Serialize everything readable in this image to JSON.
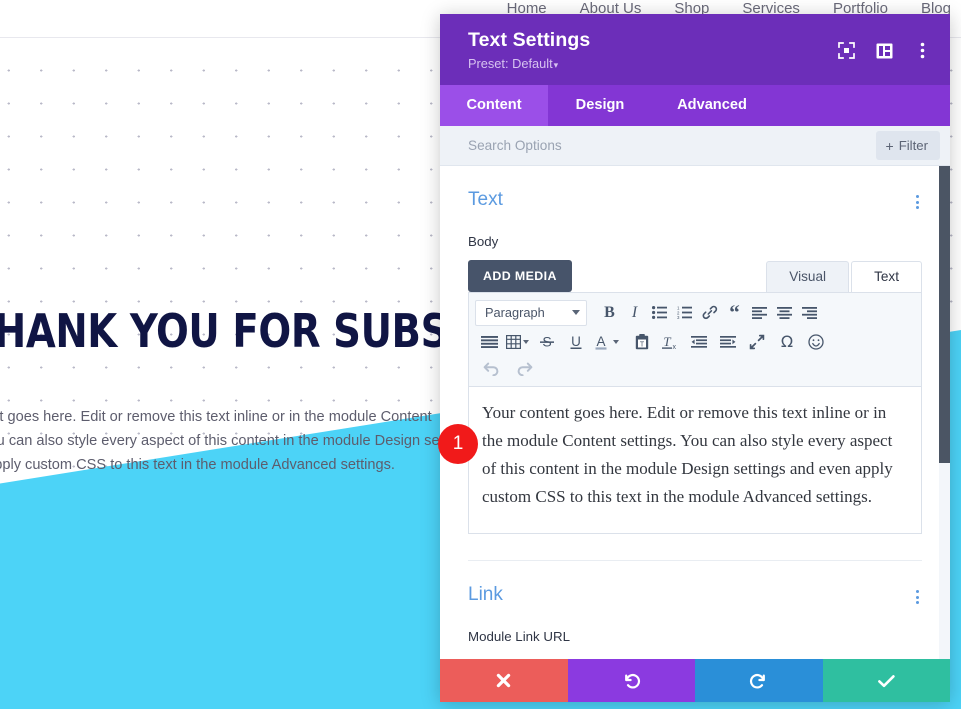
{
  "background_page": {
    "nav": {
      "items": [
        {
          "label": "Home"
        },
        {
          "label": "About Us"
        },
        {
          "label": "Shop"
        },
        {
          "label": "Services"
        },
        {
          "label": "Portfolio"
        },
        {
          "label": "Blog"
        }
      ]
    },
    "hero": {
      "heading": "THANK YOU FOR SUBSCRIBING!",
      "body": "Your content goes here. Edit or remove this text inline or in the module Content settings. You can also style every aspect of this content in the module Design settings and even apply custom CSS to this text in the module Advanced settings."
    },
    "colors": {
      "wedge": "#4cd3f7",
      "heading": "#101544"
    }
  },
  "step_badge": {
    "number": "1",
    "color": "#f11a1a"
  },
  "modal": {
    "header": {
      "title": "Text Settings",
      "preset_label": "Preset: Default",
      "preset_caret": "▾",
      "icons": [
        {
          "name": "focus-target-icon"
        },
        {
          "name": "panel-layout-icon"
        },
        {
          "name": "more-vertical-icon"
        }
      ],
      "color": "#6c2eb9"
    },
    "tabs": [
      {
        "label": "Content",
        "active": true
      },
      {
        "label": "Design",
        "active": false
      },
      {
        "label": "Advanced",
        "active": false
      }
    ],
    "search": {
      "placeholder": "Search Options",
      "value": "",
      "filter_label": "Filter",
      "filter_plus": "+"
    },
    "sections": [
      {
        "title": "Text",
        "field_label": "Body",
        "add_media_label": "ADD MEDIA",
        "mode_tabs": [
          {
            "label": "Visual",
            "active": false
          },
          {
            "label": "Text",
            "active": true
          }
        ],
        "toolbar": {
          "format_select": "Paragraph",
          "row1": [
            {
              "name": "bold-icon",
              "glyph": "B"
            },
            {
              "name": "italic-icon",
              "glyph": "I"
            },
            {
              "name": "bulleted-list-icon"
            },
            {
              "name": "numbered-list-icon"
            },
            {
              "name": "link-icon"
            },
            {
              "name": "blockquote-icon"
            },
            {
              "name": "align-left-icon"
            },
            {
              "name": "align-center-icon"
            },
            {
              "name": "align-right-icon"
            }
          ],
          "row2": [
            {
              "name": "align-justify-icon"
            },
            {
              "name": "table-icon"
            },
            {
              "name": "strikethrough-icon",
              "glyph": "S"
            },
            {
              "name": "underline-icon",
              "glyph": "U"
            },
            {
              "name": "text-color-icon",
              "glyph": "A"
            },
            {
              "name": "paste-as-text-icon"
            },
            {
              "name": "clear-formatting-icon"
            },
            {
              "name": "outdent-icon"
            },
            {
              "name": "indent-icon"
            },
            {
              "name": "fullscreen-icon"
            },
            {
              "name": "special-character-icon",
              "glyph": "Ω"
            },
            {
              "name": "emoji-icon"
            }
          ],
          "row3": [
            {
              "name": "undo-icon"
            },
            {
              "name": "redo-icon"
            }
          ]
        },
        "editor_text": "Your content goes here. Edit or remove this text inline or in the module Content settings. You can also style every aspect of this content in the module Design settings and even apply custom CSS to this text in the module Advanced settings."
      },
      {
        "title": "Link",
        "field_label": "Module Link URL"
      }
    ],
    "footer_actions": [
      {
        "name": "cancel-button",
        "icon": "close-icon",
        "color": "#ec5d5a"
      },
      {
        "name": "undo-button",
        "icon": "undo-icon",
        "color": "#8b3ae0"
      },
      {
        "name": "redo-button",
        "icon": "redo-icon",
        "color": "#2a8fd8"
      },
      {
        "name": "save-button",
        "icon": "check-icon",
        "color": "#2fbfa0"
      }
    ]
  }
}
